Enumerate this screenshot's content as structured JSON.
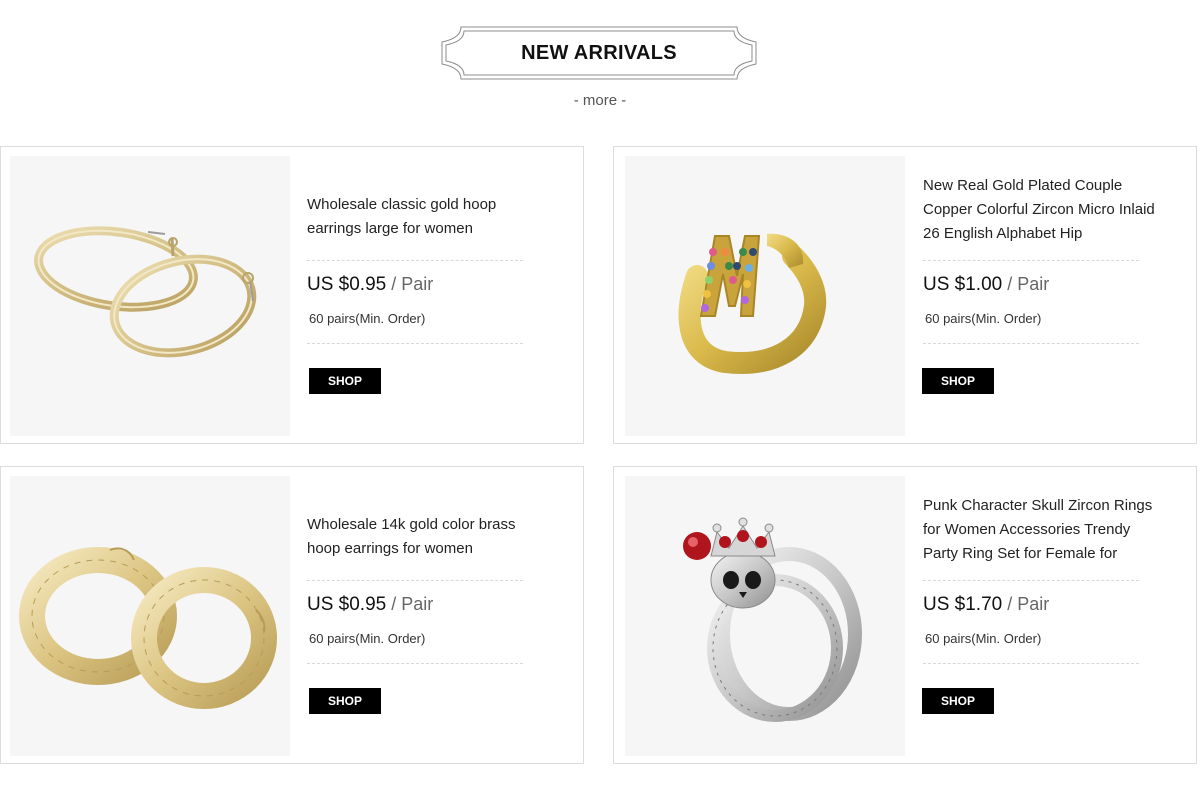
{
  "header": {
    "title": "NEW ARRIVALS",
    "more_label": "- more -"
  },
  "products": [
    {
      "title": "Wholesale classic gold hoop earrings large for women",
      "price": "US $0.95",
      "unit": " / Pair",
      "min_order": "60 pairs(Min. Order)",
      "shop_label": "SHOP",
      "image": "gold-twisted-hoop-earrings"
    },
    {
      "title": "New Real Gold Plated Couple Copper Colorful Zircon Micro Inlaid 26 English Alphabet Hip",
      "price": "US $1.00",
      "unit": " / Pair",
      "min_order": "60 pairs(Min. Order)",
      "shop_label": "SHOP",
      "image": "gold-letter-m-ring"
    },
    {
      "title": "Wholesale 14k gold color brass hoop earrings for women",
      "price": "US $0.95",
      "unit": " / Pair",
      "min_order": "60 pairs(Min. Order)",
      "shop_label": "SHOP",
      "image": "gold-wide-hoop-earrings"
    },
    {
      "title": "Punk Character Skull Zircon Rings for Women Accessories Trendy Party Ring Set for Female for",
      "price": "US $1.70",
      "unit": " / Pair",
      "min_order": "60 pairs(Min. Order)",
      "shop_label": "SHOP",
      "image": "silver-skull-crown-ring-set"
    }
  ],
  "colors": {
    "button": "#000000",
    "gold": "#dcc98e",
    "border": "#dcdcdc"
  }
}
